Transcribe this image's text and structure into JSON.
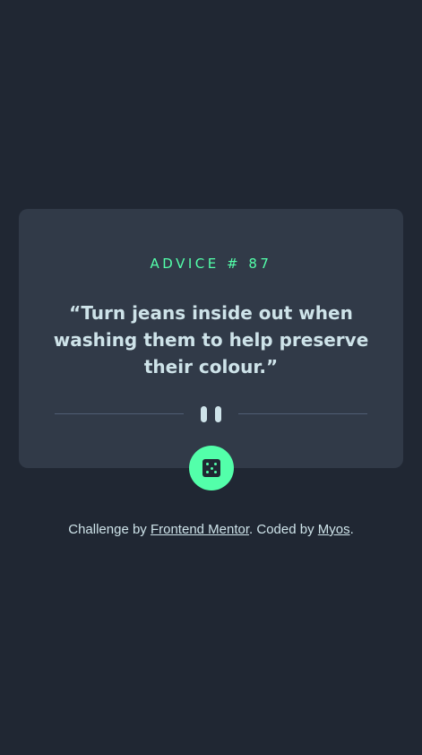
{
  "card": {
    "advice_label": "ADVICE # 87",
    "quote": "“Turn jeans inside out when washing them to help preserve their colour.”"
  },
  "divider": {
    "icon": "pause-icon"
  },
  "dice_button": {
    "icon": "dice-icon"
  },
  "attribution": {
    "prefix": "Challenge by ",
    "link1": "Frontend Mentor",
    "middle": ". Coded by ",
    "link2": "Myos",
    "suffix": "."
  },
  "colors": {
    "background": "#202733",
    "card": "#313a48",
    "accent": "#53ffaa",
    "text": "#cee3e9",
    "divider": "#4f5d74"
  }
}
